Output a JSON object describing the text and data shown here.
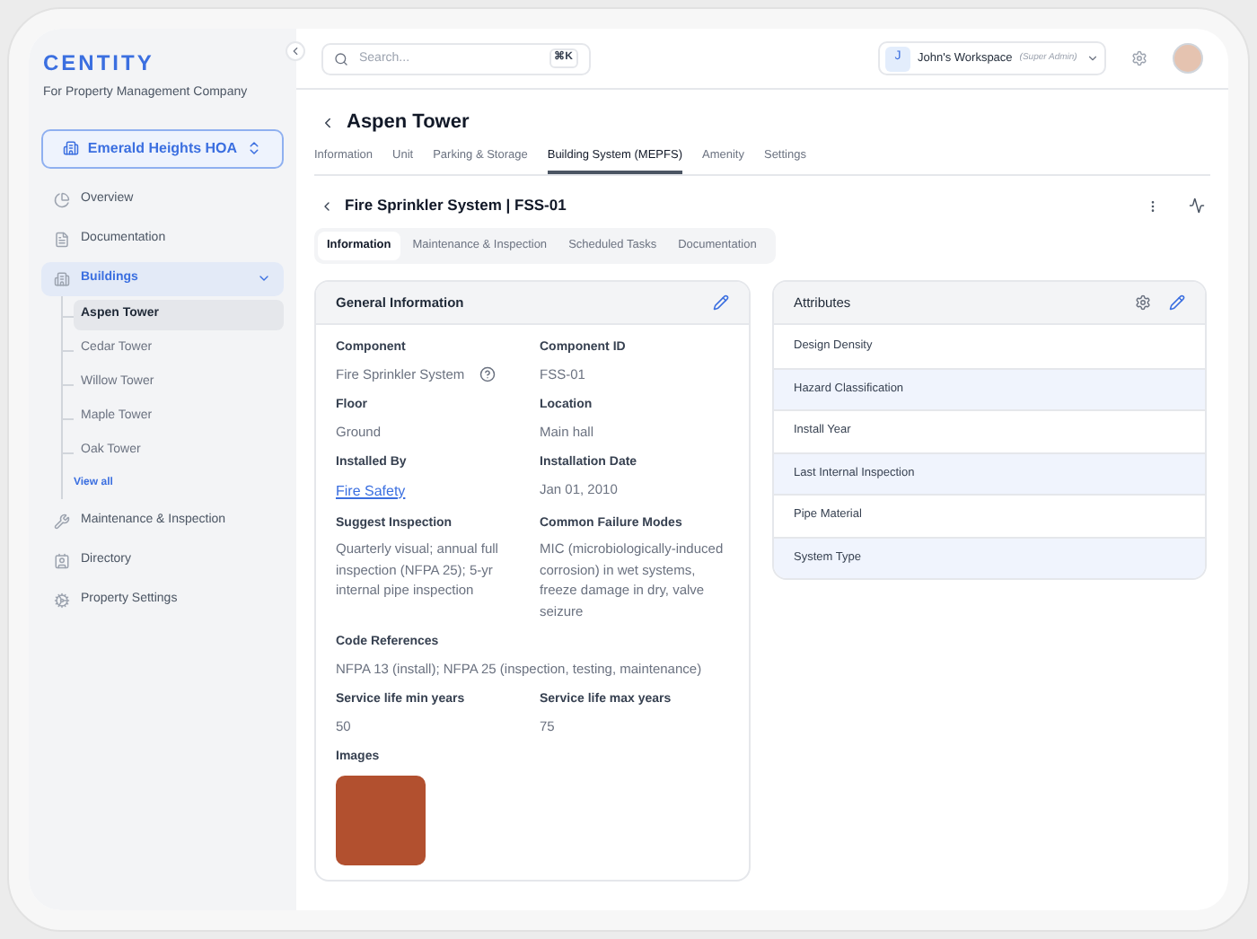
{
  "brand": {
    "name": "CENTITY",
    "tagline": "For Property Management Company"
  },
  "property_selector": {
    "label": "Emerald Heights HOA"
  },
  "sidebar": {
    "items": [
      {
        "label": "Overview",
        "selected": false
      },
      {
        "label": "Documentation",
        "selected": false
      },
      {
        "label": "Buildings",
        "selected": true,
        "expanded": true,
        "children": [
          {
            "label": "Aspen Tower",
            "selected": true
          },
          {
            "label": "Cedar Tower",
            "selected": false
          },
          {
            "label": "Willow Tower",
            "selected": false
          },
          {
            "label": "Maple Tower",
            "selected": false
          },
          {
            "label": "Oak Tower",
            "selected": false
          }
        ],
        "view_all": "View all"
      },
      {
        "label": "Maintenance & Inspection",
        "selected": false
      },
      {
        "label": "Directory",
        "selected": false
      },
      {
        "label": "Property Settings",
        "selected": false
      }
    ]
  },
  "topbar": {
    "search": {
      "placeholder": "Search...",
      "shortcut": "⌘K"
    },
    "workspace": {
      "initial": "J",
      "name": "John's Workspace",
      "role": "(Super Admin)"
    }
  },
  "page": {
    "title": "Aspen Tower"
  },
  "tabs": [
    {
      "label": "Information",
      "selected": false
    },
    {
      "label": "Unit",
      "selected": false
    },
    {
      "label": "Parking & Storage",
      "selected": false
    },
    {
      "label": "Building System (MEPFS)",
      "selected": true
    },
    {
      "label": "Amenity",
      "selected": false
    },
    {
      "label": "Settings",
      "selected": false
    }
  ],
  "component": {
    "title": "Fire Sprinkler System | FSS-01"
  },
  "subtabs": [
    {
      "label": "Information",
      "selected": true
    },
    {
      "label": "Maintenance & Inspection",
      "selected": false
    },
    {
      "label": "Scheduled Tasks",
      "selected": false
    },
    {
      "label": "Documentation",
      "selected": false
    }
  ],
  "general_information": {
    "title": "General Information",
    "rows": [
      [
        {
          "label": "Component",
          "value": "Fire Sprinkler System",
          "kind": "help"
        },
        {
          "label": "Component ID",
          "value": "FSS-01",
          "kind": "text"
        }
      ],
      [
        {
          "label": "Floor",
          "value": "Ground",
          "kind": "text"
        },
        {
          "label": "Location",
          "value": "Main hall",
          "kind": "text"
        }
      ],
      [
        {
          "label": "Installed By",
          "value": "Fire Safety",
          "kind": "link"
        },
        {
          "label": "Installation Date",
          "value": "Jan 01, 2010",
          "kind": "text"
        }
      ],
      [
        {
          "label": "Suggest Inspection",
          "value": "Quarterly visual; annual full inspection (NFPA 25); 5-yr internal pipe inspection",
          "kind": "text"
        },
        {
          "label": "Common Failure Modes",
          "value": "MIC (microbiologically-induced corrosion) in wet systems, freeze damage in dry, valve seizure",
          "kind": "text"
        }
      ],
      [
        {
          "label": "Code References",
          "value": "NFPA 13 (install); NFPA 25 (inspection, testing, maintenance)",
          "kind": "text"
        }
      ],
      [
        {
          "label": "Service life min years",
          "value": "50",
          "kind": "text"
        },
        {
          "label": "Service life max years",
          "value": "75",
          "kind": "text"
        }
      ]
    ],
    "images_label": "Images"
  },
  "attributes": {
    "title": "Attributes",
    "items": [
      "Design Density",
      "Hazard Classification",
      "Install Year",
      "Last Internal Inspection",
      "Pipe Material",
      "System Type"
    ]
  }
}
